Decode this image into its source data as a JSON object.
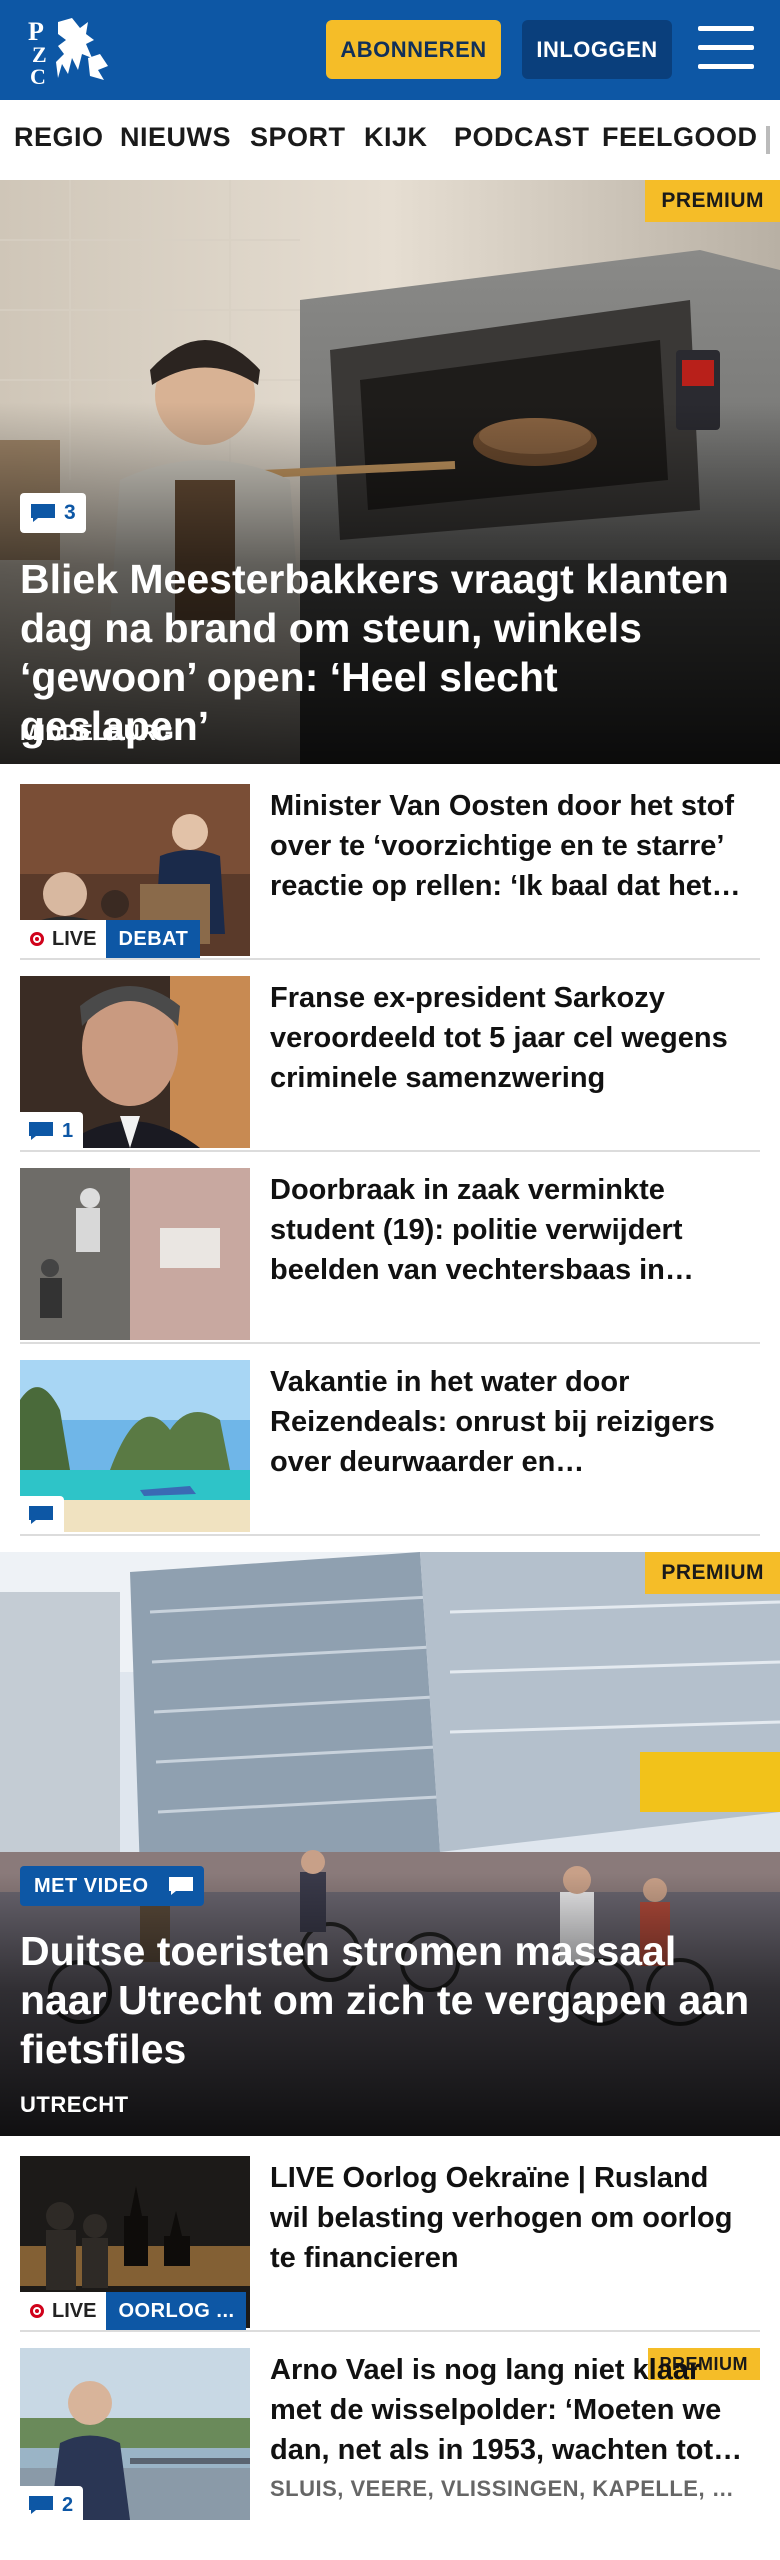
{
  "header": {
    "logo_text": "PZC",
    "subscribe_label": "ABONNEREN",
    "login_label": "INLOGGEN",
    "colors": {
      "brand": "#0d57a5",
      "accent": "#f5bd28"
    }
  },
  "nav": {
    "items": [
      {
        "label": "REGIO"
      },
      {
        "label": "NIEUWS"
      },
      {
        "label": "SPORT"
      },
      {
        "label": "KIJK"
      },
      {
        "label": "PODCAST"
      },
      {
        "label": "FEELGOOD"
      }
    ]
  },
  "hero1": {
    "premium": "PREMIUM",
    "comments": "3",
    "title": "Bliek Meesterbakkers vraagt klanten dag na brand om steun, winkels ‘gewoon’ open: ‘Heel slecht geslapen’",
    "location": "MIDDELBURG"
  },
  "list1": [
    {
      "title": "Minister Van Oosten door het stof over te ‘voorzichtige en te starre’ reactie op rellen: ‘Ik baal dat het zo gelopen is’",
      "live": "LIVE",
      "category": "DEBAT"
    },
    {
      "title": "Franse ex-president Sarkozy veroordeeld tot 5 jaar cel wegens criminele samenzwering",
      "comments": "1"
    },
    {
      "title": "Doorbraak in zaak verminkte student (19): politie verwijdert beelden van vechtersbaas in opspraak"
    },
    {
      "title": "Vakantie in het water door Reizendeals: onrust bij reizigers over deurwaarder en reispakketten",
      "comments": ""
    }
  ],
  "hero2": {
    "premium": "PREMIUM",
    "video_label": "MET VIDEO",
    "title": "Duitse toeristen stromen massaal naar Utrecht om zich te vergapen aan fietsfiles",
    "location": "UTRECHT"
  },
  "list2": [
    {
      "title": "LIVE Oorlog Oekraïne | Rusland wil belasting verhogen om oorlog te financieren",
      "live": "LIVE",
      "category": "OORLOG ..."
    },
    {
      "title": "Arno Vael is nog lang niet klaar met de wisselpolder: ‘Moeten we dan, net als in 1953, wachten tot het misgaat?’",
      "premium": "PREMIUM",
      "comments": "2",
      "location": "SLUIS, VEERE, VLISSINGEN, KAPELLE, GOES"
    }
  ]
}
